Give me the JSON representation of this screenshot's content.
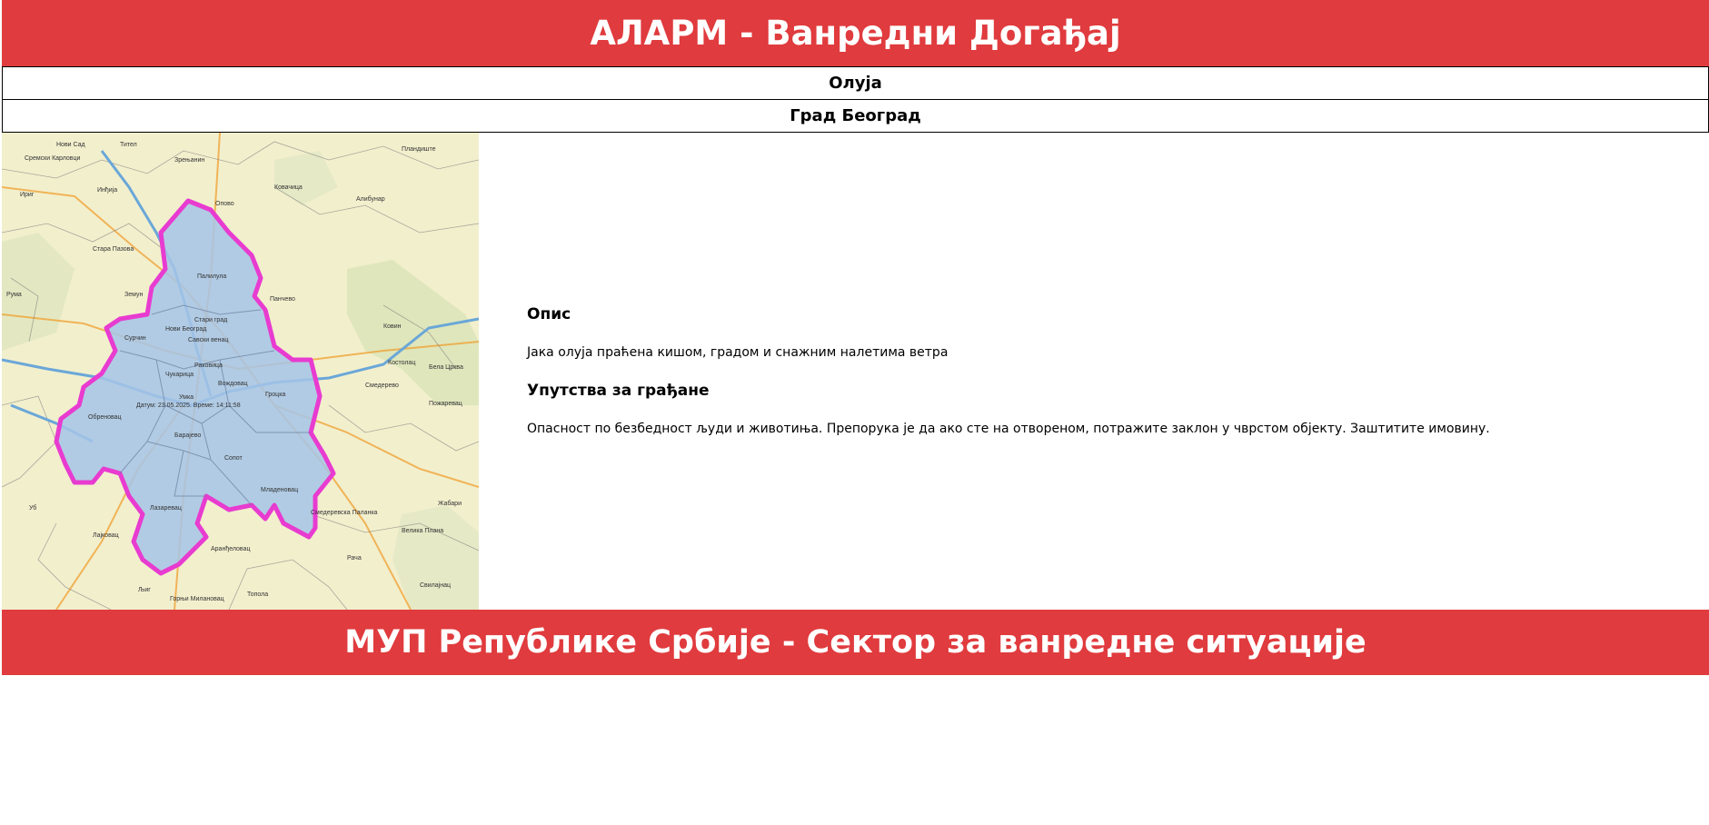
{
  "header": {
    "title": "АЛАРМ - Ванредни Догађај"
  },
  "event": {
    "type": "Олуја",
    "region": "Град Београд"
  },
  "map": {
    "places": [
      "Нови Сад",
      "Сремски Карловци",
      "Тител",
      "Зрењанин",
      "Ковачица",
      "Ириг",
      "Инђија",
      "Стара Пазова",
      "Опово",
      "Алибунар",
      "Пландиште",
      "Рума",
      "Земун",
      "Панчево",
      "Палилула",
      "Стари град",
      "Нови Београд",
      "Савски венац",
      "Сурчин",
      "Чукарица",
      "Вождовац",
      "Раковица",
      "Гроцка",
      "Ковин",
      "Обреновац",
      "Умка",
      "Барајево",
      "Сопот",
      "Младеновац",
      "Лазаревац",
      "Смедеревска Паланка",
      "Аранђеловац",
      "Смедерево",
      "Пожаревац",
      "Костолац",
      "Бела Црква",
      "Велика Плана",
      "Жабари",
      "Љиг",
      "Горњи Милановац",
      "Тополa",
      "Уб",
      "Лајковац",
      "Рача",
      "Свилајнац"
    ],
    "stamp": "Датум: 23.05.2025. Време: 14:11:58"
  },
  "info": {
    "description_heading": "Опис",
    "description_text": "Јака олуја праћена кишом, градом и снажним налетима ветра",
    "instructions_heading": "Упутства за грађане",
    "instructions_text": "Опасност по безбедност људи и животиња. Препорука је да ако сте на отвореном, потражите заклон у чврстом објекту. Заштитите имовину."
  },
  "footer": {
    "title": "МУП Републике Србије - Сектор за ванредне ситуације"
  },
  "colors": {
    "banner": "#e03b3e",
    "border_outline": "#e83bd0",
    "area_fill": "#a6c4e8"
  }
}
